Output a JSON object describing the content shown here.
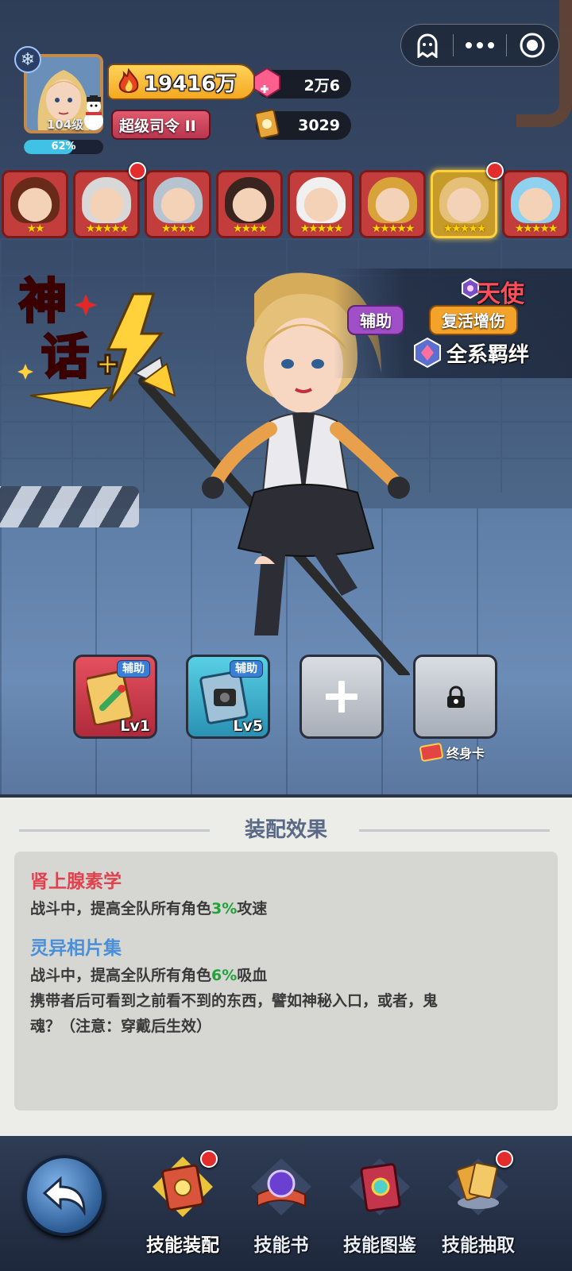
{
  "mini_program": {
    "buttons": [
      "ghost-icon",
      "more-icon",
      "target-icon"
    ]
  },
  "profile": {
    "level": "104级",
    "exp_percent_text": "62%",
    "exp_fraction": 0.62,
    "power": "19416万",
    "rank": "超级司令 II"
  },
  "currencies": {
    "gems": "2万6",
    "cards": "3029"
  },
  "hero_row": {
    "heroes": [
      {
        "stars": "★★",
        "red_dot": false
      },
      {
        "stars": "★★★★★",
        "red_dot": true
      },
      {
        "stars": "★★★★",
        "red_dot": false
      },
      {
        "stars": "★★★★",
        "red_dot": false
      },
      {
        "stars": "★★★★★",
        "red_dot": false
      },
      {
        "stars": "★★★★★",
        "red_dot": false
      },
      {
        "stars": "★★★★★",
        "red_dot": true,
        "selected": true
      },
      {
        "stars": "★★★★★",
        "red_dot": false
      }
    ]
  },
  "hero": {
    "name": "天使",
    "role_tag": "辅助",
    "skill_tag": "复活增伤",
    "bond": "全系羁绊",
    "myth_logo": "神话+"
  },
  "slots": [
    {
      "tag": "辅助",
      "level": "Lv1",
      "type": "red"
    },
    {
      "tag": "辅助",
      "level": "Lv5",
      "type": "blue"
    },
    {
      "type": "empty",
      "icon": "plus-icon"
    },
    {
      "type": "locked",
      "icon": "lock-icon",
      "caption": "终身卡"
    }
  ],
  "effects_panel": {
    "title": "装配效果",
    "effects": [
      {
        "name": "肾上腺素学",
        "name_color": "#e0424e",
        "line_pre": "战斗中，提高全队所有角色",
        "line_value": "3%",
        "line_post": "攻速"
      },
      {
        "name": "灵异相片集",
        "name_color": "#4a8fd8",
        "line_pre": "战斗中，提高全队所有角色",
        "line_value": "6%",
        "line_post": "吸血",
        "extra_line_1": "携带者后可看到之前看不到的东西，譬如神秘入口，或者，鬼",
        "extra_line_2": "魂？（注意：穿戴后生效）"
      }
    ]
  },
  "bottom_nav": {
    "items": [
      {
        "label": "技能装配",
        "active": true,
        "red_dot": true
      },
      {
        "label": "技能书",
        "active": false,
        "red_dot": false
      },
      {
        "label": "技能图鉴",
        "active": false,
        "red_dot": false
      },
      {
        "label": "技能抽取",
        "active": false,
        "red_dot": true
      }
    ]
  },
  "colors": {
    "highlight_green": "#23a13b",
    "accent_gold": "#ffd23b",
    "name_red": "#ff4d5a"
  }
}
